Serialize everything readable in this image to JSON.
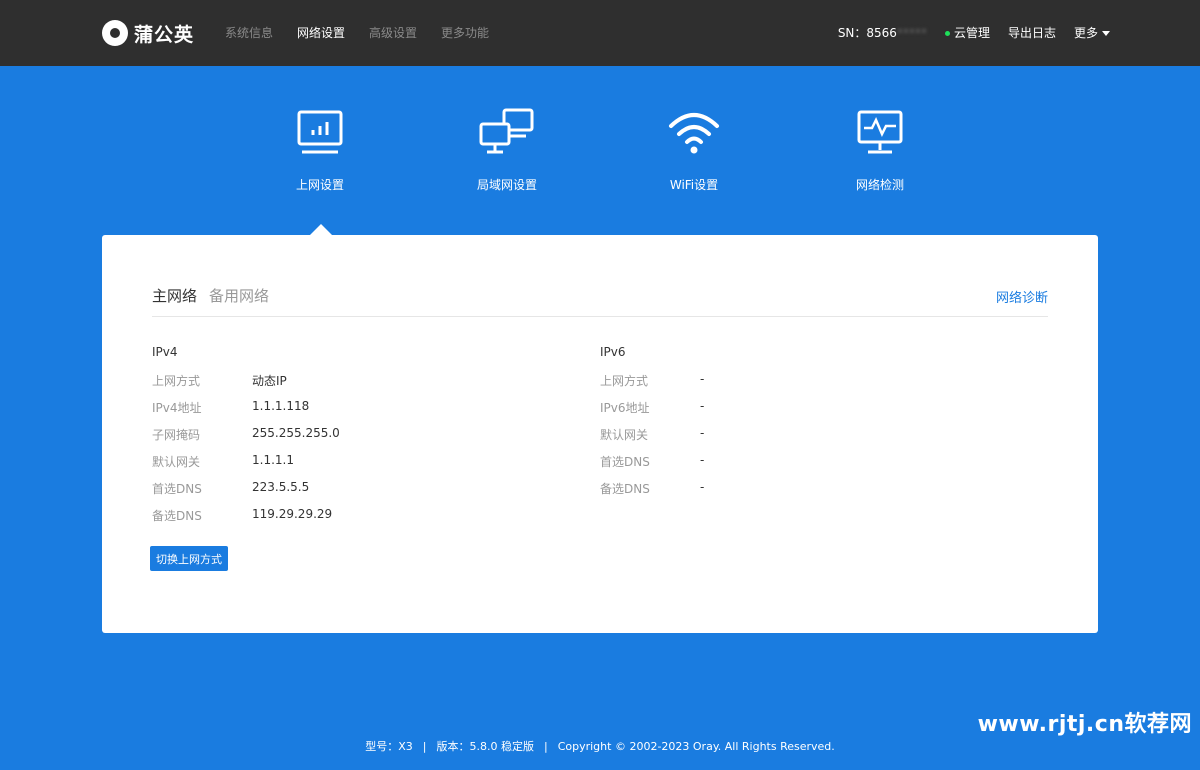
{
  "header": {
    "brand": "蒲公英",
    "nav": [
      {
        "label": "系统信息",
        "active": false
      },
      {
        "label": "网络设置",
        "active": true
      },
      {
        "label": "高级设置",
        "active": false
      },
      {
        "label": "更多功能",
        "active": false
      }
    ],
    "sn_prefix": "SN：8566",
    "sn_masked": "*****",
    "cloud_label": "云管理",
    "export_log_label": "导出日志",
    "more_label": "更多"
  },
  "features": [
    {
      "label": "上网设置",
      "icon": "monitor-chart-icon",
      "active": true
    },
    {
      "label": "局域网设置",
      "icon": "lan-monitors-icon",
      "active": false
    },
    {
      "label": "WiFi设置",
      "icon": "wifi-icon",
      "active": false
    },
    {
      "label": "网络检测",
      "icon": "monitor-pulse-icon",
      "active": false
    }
  ],
  "card": {
    "tab_main": "主网络",
    "tab_backup": "备用网络",
    "diagnose_link": "网络诊断",
    "ipv4": {
      "title": "IPv4",
      "rows": [
        {
          "label": "上网方式",
          "value": "动态IP"
        },
        {
          "label": "IPv4地址",
          "value": "1.1.1.118"
        },
        {
          "label": "子网掩码",
          "value": "255.255.255.0"
        },
        {
          "label": "默认网关",
          "value": "1.1.1.1"
        },
        {
          "label": "首选DNS",
          "value": "223.5.5.5"
        },
        {
          "label": "备选DNS",
          "value": "119.29.29.29"
        }
      ]
    },
    "ipv6": {
      "title": "IPv6",
      "rows": [
        {
          "label": "上网方式",
          "value": "-"
        },
        {
          "label": "IPv6地址",
          "value": "-"
        },
        {
          "label": "默认网关",
          "value": "-"
        },
        {
          "label": "首选DNS",
          "value": "-"
        },
        {
          "label": "备选DNS",
          "value": "-"
        }
      ]
    },
    "switch_button": "切换上网方式"
  },
  "footer": {
    "model": "型号：X3",
    "version": "版本：5.8.0 稳定版",
    "copyright": "Copyright © 2002-2023 Oray. All Rights Reserved."
  },
  "watermark": "www.rjtj.cn软荐网",
  "colors": {
    "background": "#1a7ce0",
    "topbar": "#2f2f2f",
    "accent": "#1a7ce0",
    "online_dot": "#1ee05a"
  }
}
